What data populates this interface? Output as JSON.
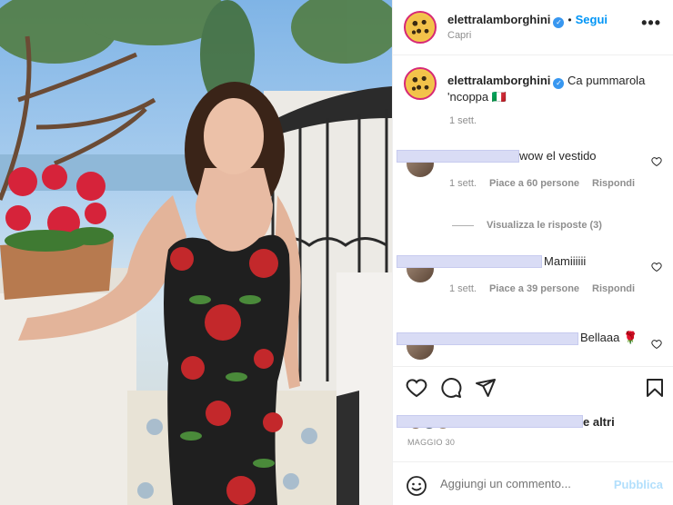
{
  "post": {
    "username": "elettralamborghini",
    "follow_label": "Segui",
    "location": "Capri",
    "more_label": "•••",
    "verified_mark": "✓"
  },
  "caption": {
    "username": "elettralamborghini",
    "text": "Ca pummarola 'ncoppa 🇮🇹",
    "age": "1 sett."
  },
  "comments": [
    {
      "text": "wow el vestido",
      "age": "1 sett.",
      "likes": "Piace a 60 persone",
      "reply": "Rispondi"
    },
    {
      "text": "Mamiiiiii",
      "age": "1 sett.",
      "likes": "Piace a 39 persone",
      "reply": "Rispondi"
    },
    {
      "text": "Bellaaa 🌹"
    }
  ],
  "view_replies": "Visualizza le risposte (3)",
  "likes_summary": "e altri",
  "post_date": "MAGGIO 30",
  "comment_input": {
    "placeholder": "Aggiungi un commento..."
  },
  "publish_label": "Pubblica",
  "colors": {
    "accent": "#0095f6",
    "publish_disabled": "#b2dffc",
    "verified": "#3897f0"
  }
}
